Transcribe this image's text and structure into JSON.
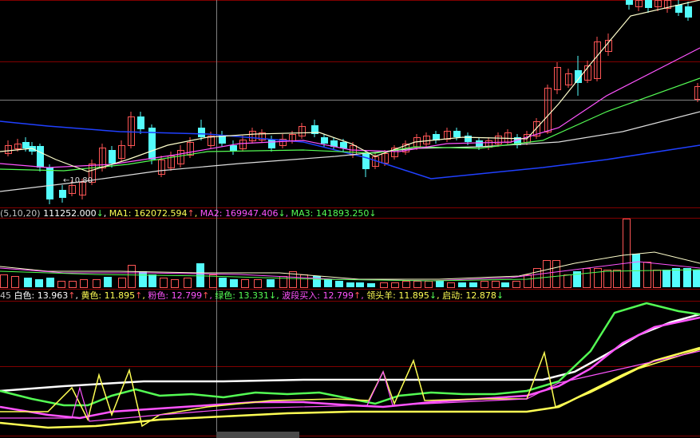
{
  "low_price": "10.80",
  "volume_bar": {
    "prefix": "(5,10,20)",
    "vol_value": "111252.000",
    "vol_arrow": "↓",
    "ma1_label": "MA1:",
    "ma1_value": "162072.594",
    "ma1_arrow": "↑",
    "ma2_label": "MA2:",
    "ma2_value": "169947.406",
    "ma2_arrow": "↓",
    "ma3_label": "MA3:",
    "ma3_value": "141893.250",
    "ma3_arrow": "↓"
  },
  "indicator_bar": {
    "prefix": "45",
    "white_label": "白色:",
    "white_value": "13.963",
    "white_arrow": "↑",
    "yellow_label": "黄色:",
    "yellow_value": "11.895",
    "yellow_arrow": "↑",
    "pink_label": "粉色:",
    "pink_value": "12.799",
    "pink_arrow": "↑",
    "green_label": "绿色:",
    "green_value": "13.331",
    "green_arrow": "↓",
    "wave_label": "波段买入:",
    "wave_value": "12.799",
    "wave_arrow": "↑",
    "lead_label": "领头羊:",
    "lead_value": "11.895",
    "lead_arrow": "↓",
    "start_label": "启动:",
    "start_value": "12.878",
    "start_arrow": "↓"
  },
  "colors": {
    "up": "#ff5555",
    "down": "#54fcfc",
    "ma_white": "#ffffff",
    "ma_yellow": "#ffff54",
    "ma_pink": "#ff54ff",
    "ma_green": "#54fc54",
    "ma_blue": "#2040ff",
    "grid": "#800000",
    "crosshair": "#808080"
  }
}
